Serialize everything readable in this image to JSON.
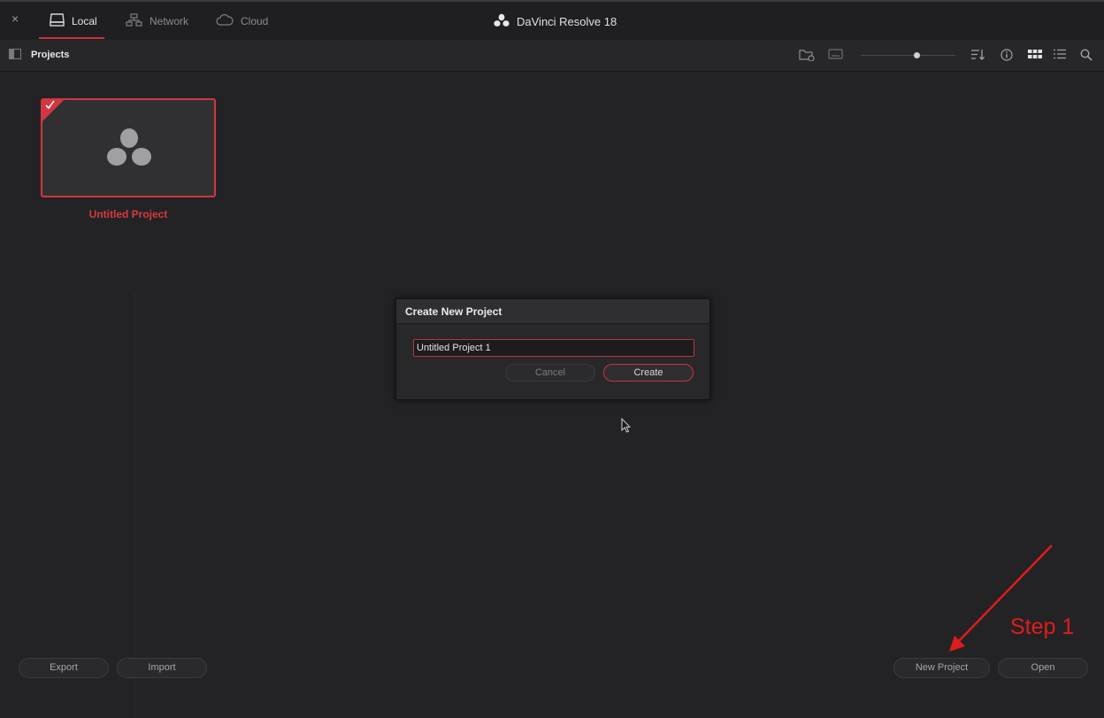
{
  "window": {
    "close_glyph": "×",
    "app_title": "DaVinci Resolve 18",
    "tabs": [
      {
        "label": "Local",
        "icon": "drive-icon",
        "active": true
      },
      {
        "label": "Network",
        "icon": "network-icon",
        "active": false
      },
      {
        "label": "Cloud",
        "icon": "cloud-icon",
        "active": false
      }
    ]
  },
  "toolbar": {
    "title": "Projects",
    "icons": [
      "new-folder-icon",
      "keyboard-icon",
      "zoom-slider",
      "sort-icon",
      "info-icon",
      "grid-view-icon",
      "list-view-icon",
      "search-icon"
    ]
  },
  "projects": [
    {
      "name": "Untitled Project",
      "selected": true
    }
  ],
  "dialog": {
    "title": "Create New Project",
    "input_value": "Untitled Project 1",
    "cancel_label": "Cancel",
    "create_label": "Create"
  },
  "footer": {
    "export_label": "Export",
    "import_label": "Import",
    "new_project_label": "New Project",
    "open_label": "Open"
  },
  "annotation": {
    "text": "Step 1",
    "color": "#e21b1b"
  },
  "colors": {
    "accent": "#d2363e",
    "background": "#232326"
  }
}
